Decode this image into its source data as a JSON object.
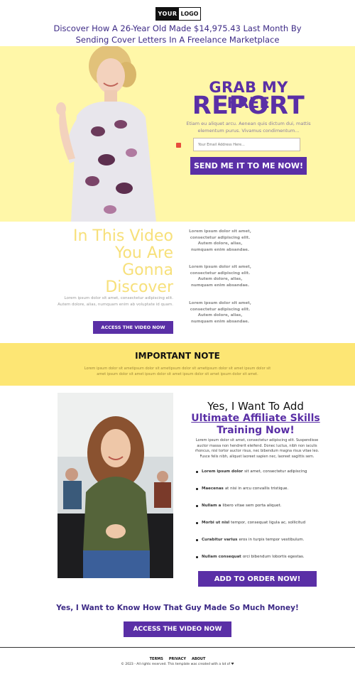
{
  "header": {
    "logo_left": "YOUR",
    "logo_right": "LOGO",
    "headline": "Discover How A 26-Year Old Made $14,975.43 Last Month By Sending Cover Letters In A Freelance Marketplace"
  },
  "hero": {
    "title_line1": "GRAB MY FREE",
    "title_line2": "REPORT",
    "text": "Etiam eu aliquet arcu. Aenean quis dictum dui, mattis elementum purus. Vivamus condimentum...",
    "email_placeholder": "Your Email Address Here...",
    "button_label": "SEND ME IT TO ME NOW!",
    "bg_color": "#fff7a8",
    "accent": "#5a2fa6"
  },
  "video": {
    "title_line1": "In This Video",
    "title_line2": "You Are",
    "title_line3": "Gonna",
    "title_line4": "Discover",
    "text": "Lorem ipsum dolor sit amet, consectetur adipiscing elit. Autem dolore, alias, numquam enim ab voluptate id quam.",
    "button_label": "ACCESS THE VIDEO NOW",
    "side_blocks": [
      "Lorem ipsum dolor sit amet, consectetur adipiscing elit. Autem dolore, alias, numquam enim absandae.",
      "Lorem ipsum dolor sit amet, consectetur adipiscing elit. Autem dolore, alias, numquam enim absandae.",
      "Lorem ipsum dolor sit amet, consectetur adipiscing elit. Autem dolore, alias, numquam enim absandae."
    ]
  },
  "note": {
    "title": "IMPORTANT NOTE",
    "text": "Lorem ipsum dolor sit ametipsum dolor sit ametipsum dolor sit ametipsum dolor sit amet ipsum dolor sit amet ipsum dolor sit amet ipsum dolor sit amet ipsum dolor sit amet ipsum dolor sit amet."
  },
  "offer": {
    "title_line1": "Yes, I Want To Add",
    "title_line2": "Ultimate Affiliate Skills",
    "title_line3": "Training Now!",
    "text": "Lorem ipsum dolor sit amet, consectetur adipiscing elit. Suspendisse auctor massa non hendrerit eleifend. Donec luctus, nibh non iaculis rhoncus, nisl tortor auctor risus, nec bibendum magna risus vitae leo. Fusce felis nibh, aliquet laoreet sapien nec, laoreet sagittis sem.",
    "bullets": [
      {
        "bold": "Lorem ipsum dolor",
        "rest": "sit amet, consectetur adipiscing"
      },
      {
        "bold": "Maecenas",
        "rest": "at nisi in arcu convallis tristique."
      },
      {
        "bold": "Nullam a",
        "rest": "libero vitae sem porta aliquet."
      },
      {
        "bold": "Morbi ut nisl",
        "rest": "tempor, consequat ligula ac, sollicitud"
      },
      {
        "bold": "Curabitur varius",
        "rest": "eros in turpis tempor vestibulum."
      },
      {
        "bold": "Nullam consequat",
        "rest": "orci bibendum lobortis egestas."
      }
    ],
    "button_label": "ADD TO ORDER NOW!"
  },
  "cta": {
    "title": "Yes, I Want to Know How That Guy Made So Much Money!",
    "button_label": "ACCESS THE VIDEO NOW"
  },
  "footer": {
    "links": [
      "TERMS",
      "PRIVACY",
      "ABOUT"
    ],
    "copyright": "© 2023 - All rights reserved. This template was created with a lot of ♥"
  }
}
